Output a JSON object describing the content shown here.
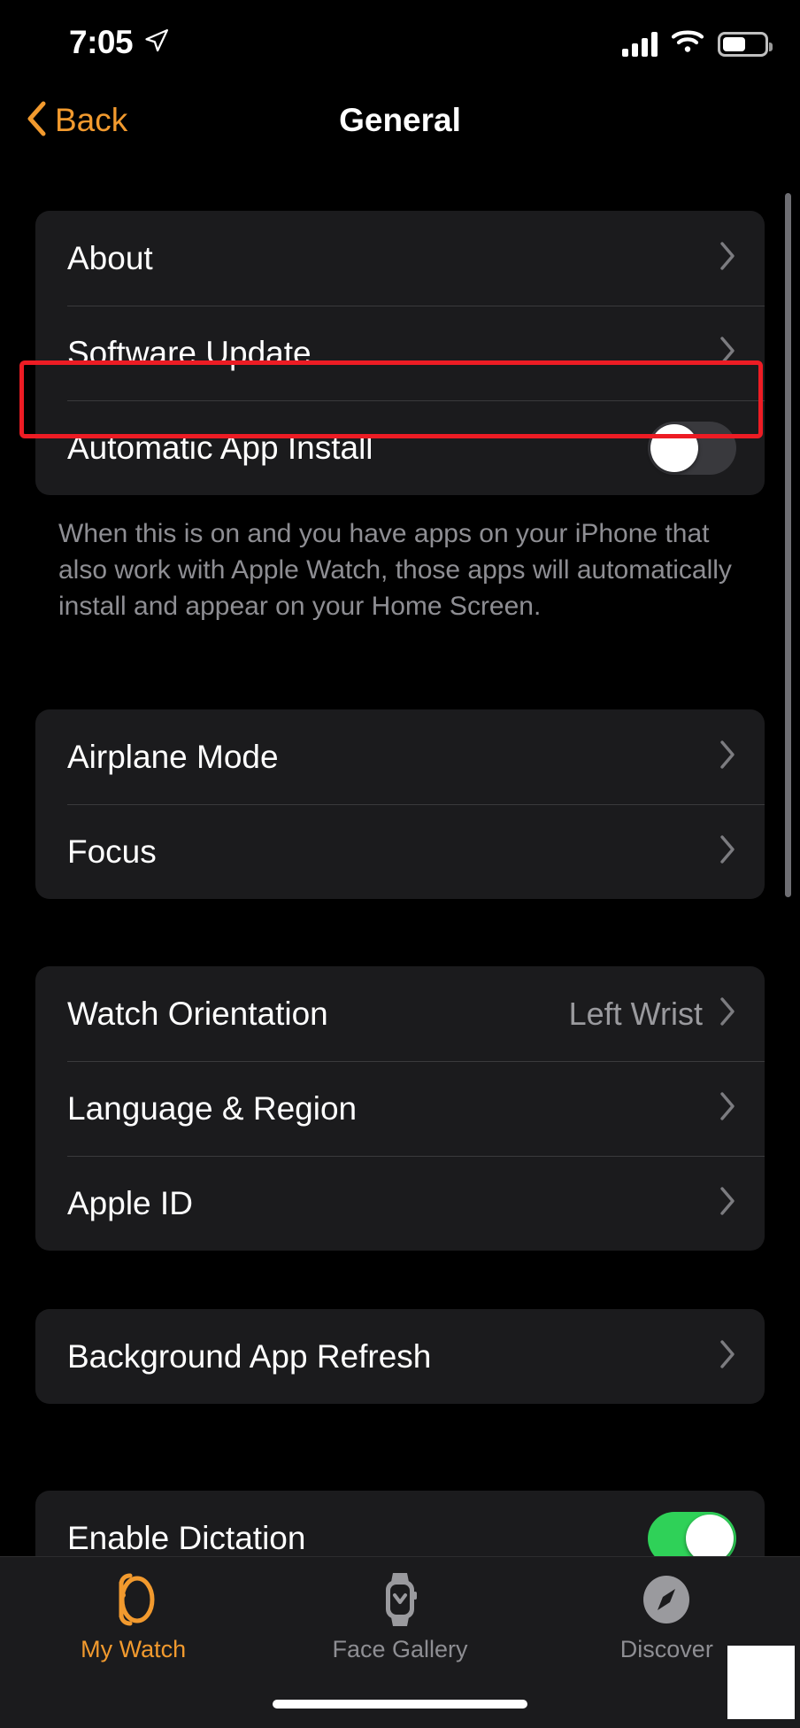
{
  "status_bar": {
    "time": "7:05",
    "location_icon": "location-arrow-icon",
    "cellular_icon": "cellular-bars-icon",
    "wifi_icon": "wifi-icon",
    "battery_icon": "battery-icon",
    "battery_level_percent": 55
  },
  "nav": {
    "back_label": "Back",
    "back_icon": "chevron-left-icon",
    "title": "General"
  },
  "colors": {
    "accent_orange": "#F29A2E",
    "toggle_on_green": "#2FD158",
    "toggle_off_gray": "#39393D",
    "row_background": "#1B1B1D",
    "page_background": "#000000",
    "highlight_red": "#ED1C24",
    "secondary_text": "#8E8E93"
  },
  "groups": [
    {
      "id": "software-group",
      "rows": [
        {
          "label": "About",
          "type": "disclosure",
          "value": "",
          "chevron": "chevron-right-icon"
        },
        {
          "label": "Software Update",
          "type": "disclosure",
          "value": "",
          "chevron": "chevron-right-icon",
          "highlighted": true
        },
        {
          "label": "Automatic App Install",
          "type": "toggle",
          "toggle_state": "off"
        }
      ],
      "footer": "When this is on and you have apps on your iPhone that also work with Apple Watch, those apps will automatically install and appear on your Home Screen."
    },
    {
      "id": "connectivity-group",
      "rows": [
        {
          "label": "Airplane Mode",
          "type": "disclosure",
          "value": "",
          "chevron": "chevron-right-icon"
        },
        {
          "label": "Focus",
          "type": "disclosure",
          "value": "",
          "chevron": "chevron-right-icon"
        }
      ]
    },
    {
      "id": "device-group",
      "rows": [
        {
          "label": "Watch Orientation",
          "type": "disclosure",
          "value": "Left Wrist",
          "chevron": "chevron-right-icon"
        },
        {
          "label": "Language & Region",
          "type": "disclosure",
          "value": "",
          "chevron": "chevron-right-icon"
        },
        {
          "label": "Apple ID",
          "type": "disclosure",
          "value": "",
          "chevron": "chevron-right-icon"
        }
      ]
    },
    {
      "id": "refresh-group",
      "rows": [
        {
          "label": "Background App Refresh",
          "type": "disclosure",
          "value": "",
          "chevron": "chevron-right-icon"
        }
      ]
    },
    {
      "id": "dictation-group",
      "rows": [
        {
          "label": "Enable Dictation",
          "type": "toggle",
          "toggle_state": "on"
        }
      ]
    }
  ],
  "tab_bar": {
    "tabs": [
      {
        "label": "My Watch",
        "icon": "apple-watch-icon",
        "active": true
      },
      {
        "label": "Face Gallery",
        "icon": "watch-face-icon",
        "active": false
      },
      {
        "label": "Discover",
        "icon": "compass-icon",
        "active": false
      }
    ]
  }
}
